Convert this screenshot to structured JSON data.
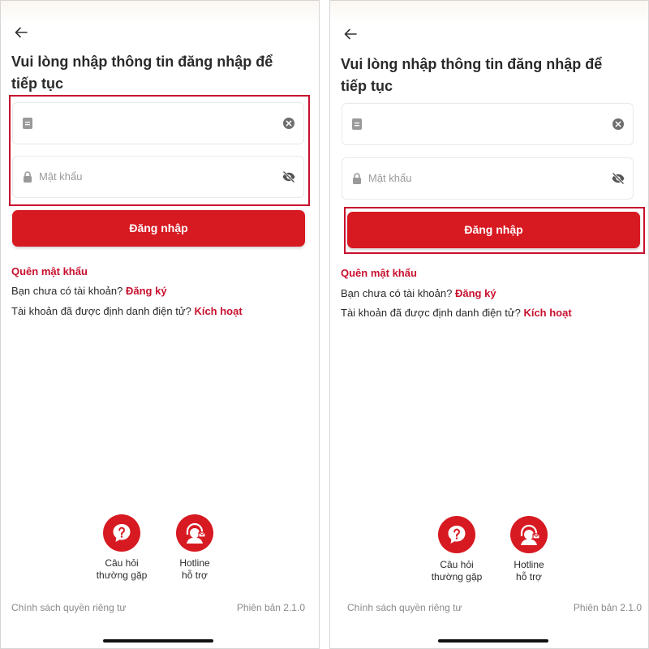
{
  "screens": [
    {
      "id": "left",
      "title": "Vui lòng nhập thông tin đăng nhập để tiếp tục",
      "username_field": {
        "value": "",
        "placeholder": ""
      },
      "password_field": {
        "value": "",
        "placeholder": "Mật khẩu"
      },
      "login_label": "Đăng nhập",
      "forgot_label": "Quên mật khẩu",
      "register_prompt": "Bạn chưa có tài khoản?",
      "register_link": "Đăng ký",
      "activate_prompt": "Tài khoản đã được định danh điện tử?",
      "activate_link": "Kích hoạt",
      "faq_line1": "Câu hỏi",
      "faq_line2": "thường gặp",
      "hotline_line1": "Hotline",
      "hotline_line2": "hỗ trợ",
      "privacy_label": "Chính sách quyền riêng tư",
      "version_label": "Phiên bản 2.1.0"
    },
    {
      "id": "right",
      "title": "Vui lòng nhập thông tin đăng nhập để tiếp tục",
      "username_field": {
        "value": "",
        "placeholder": ""
      },
      "password_field": {
        "value": "",
        "placeholder": "Mật khẩu"
      },
      "login_label": "Đăng nhập",
      "forgot_label": "Quên mật khẩu",
      "register_prompt": "Bạn chưa có tài khoản?",
      "register_link": "Đăng ký",
      "activate_prompt": "Tài khoản đã được định danh điện tử?",
      "activate_link": "Kích hoạt",
      "faq_line1": "Câu hỏi",
      "faq_line2": "thường gặp",
      "hotline_line1": "Hotline",
      "hotline_line2": "hỗ trợ",
      "privacy_label": "Chính sách quyền riêng tư",
      "version_label": "Phiên bản 2.1.0"
    }
  ],
  "icons": {
    "back": "arrow-left-icon",
    "username": "id-card-icon",
    "clear": "clear-circle-icon",
    "password": "lock-icon",
    "visibility": "eye-off-icon",
    "faq": "question-bubble-icon",
    "hotline": "support-agent-icon"
  },
  "colors": {
    "brand": "#d71921",
    "highlight": "#c8102e",
    "link": "#c8102e",
    "text": "#2a2a2a",
    "muted": "#8a8a8a"
  }
}
